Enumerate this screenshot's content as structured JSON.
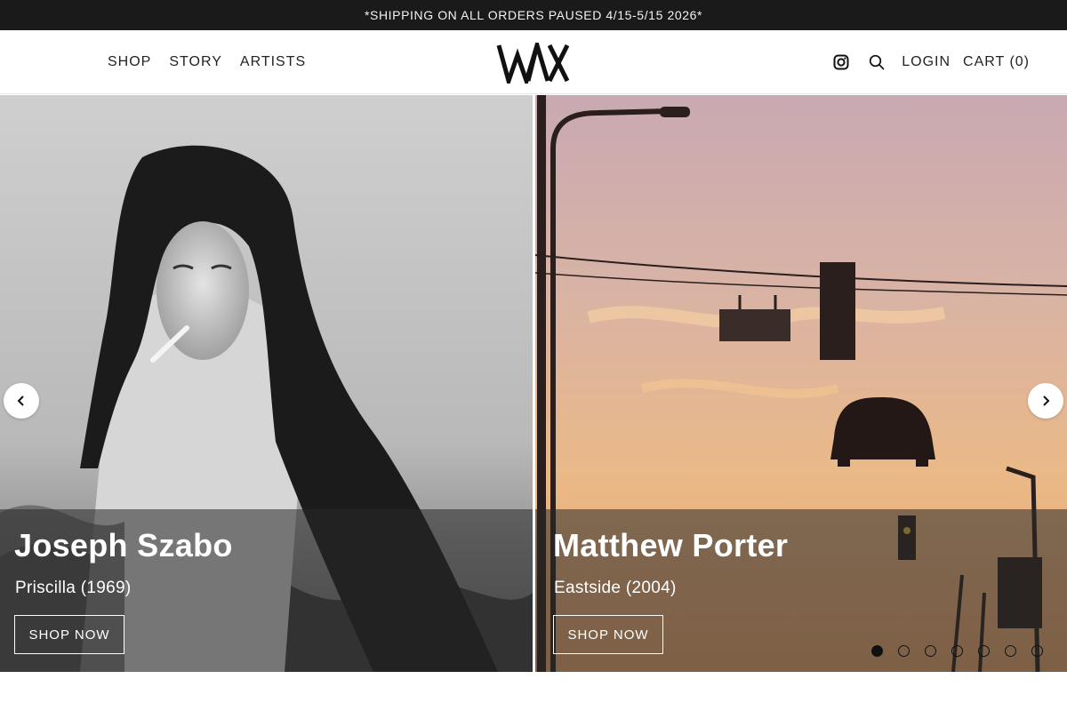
{
  "announcement": "*SHIPPING ON ALL ORDERS PAUSED 4/15-5/15 2026*",
  "nav": {
    "left": [
      "SHOP",
      "STORY",
      "ARTISTS"
    ],
    "login": "LOGIN",
    "cart": "CART (0)",
    "icons": [
      "instagram-icon",
      "search-icon"
    ]
  },
  "logo": {
    "text": "WAX"
  },
  "hero": {
    "slides": [
      {
        "artist": "Joseph Szabo",
        "work": "Priscilla (1969)",
        "cta": "SHOP NOW"
      },
      {
        "artist": "Matthew Porter",
        "work": "Eastside (2004)",
        "cta": "SHOP NOW"
      }
    ],
    "dot_count": 7,
    "active_dot": 1
  },
  "colors": {
    "announcement_bg": "#1a1a1a",
    "caption_overlay": "rgba(40,40,40,0.55)",
    "sunset_sky": "#e8b78a"
  }
}
